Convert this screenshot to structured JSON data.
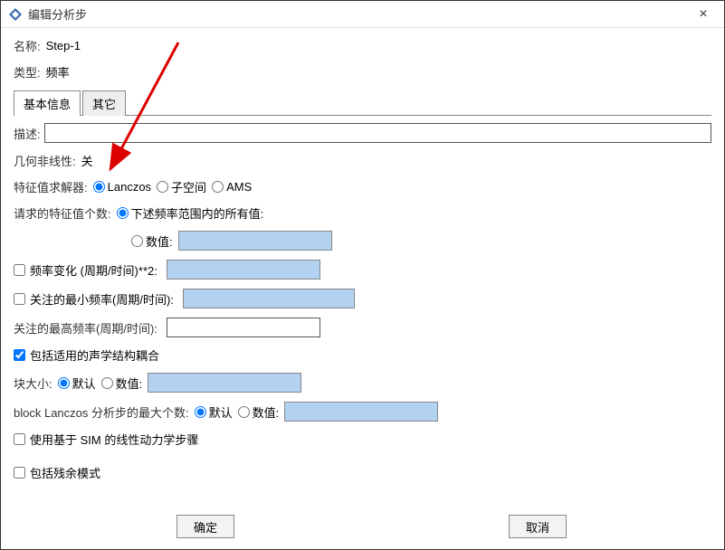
{
  "window": {
    "title": "编辑分析步",
    "close_label": "×"
  },
  "header": {
    "name_label": "名称:",
    "name_value": "Step-1",
    "type_label": "类型:",
    "type_value": "频率"
  },
  "tabs": {
    "basic": "基本信息",
    "other": "其它"
  },
  "description": {
    "label": "描述:",
    "value": ""
  },
  "geom_nonlinear": {
    "label": "几何非线性:",
    "value": "关"
  },
  "eigensolver": {
    "label": "特征值求解器:",
    "opt_lanczos": "Lanczos",
    "opt_subspace": "子空间",
    "opt_ams": "AMS"
  },
  "eigen_request": {
    "label": "请求的特征值个数:",
    "opt_range": "下述频率范围内的所有值:",
    "opt_count": "数值:"
  },
  "freq_change": {
    "label": "频率变化 (周期/时间)**2:"
  },
  "min_freq": {
    "label": "关注的最小频率(周期/时间):"
  },
  "max_freq": {
    "label": "关注的最高频率(周期/时间):"
  },
  "acoustic_coupling": {
    "label": "包括适用的声学结构耦合"
  },
  "block_size": {
    "label": "块大小:",
    "opt_default": "默认",
    "opt_value": "数值:"
  },
  "block_lanczos": {
    "label": "block Lanczos 分析步的最大个数:",
    "opt_default": "默认",
    "opt_value": "数值:"
  },
  "sim_linear": {
    "label": "使用基于 SIM 的线性动力学步骤"
  },
  "residual_modes": {
    "label": "包括残余模式"
  },
  "buttons": {
    "ok": "确定",
    "cancel": "取消"
  }
}
